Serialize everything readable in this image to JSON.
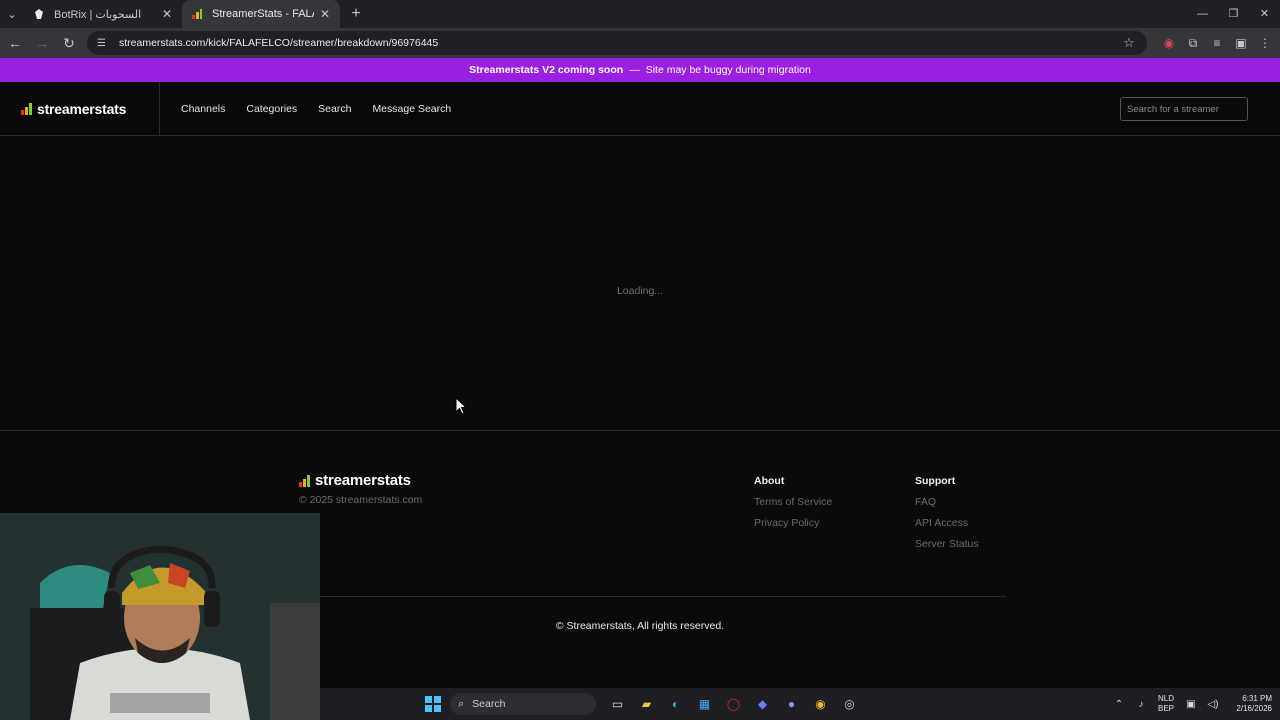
{
  "browser": {
    "tabs": [
      {
        "title": "BotRix | السحوبات",
        "favicon": "botrix-icon",
        "active": false
      },
      {
        "title": "StreamerStats - FALAFELCO Str",
        "favicon": "streamerstats-icon",
        "active": true
      }
    ],
    "url": "streamerstats.com/kick/FALAFELCO/streamer/breakdown/96976445"
  },
  "banner": {
    "strong": "Streamerstats V2 coming soon",
    "separator": "—",
    "text": "Site may be buggy during migration",
    "color": "#9b1fe0"
  },
  "header": {
    "logo": "streamerstats",
    "nav": [
      "Channels",
      "Categories",
      "Search",
      "Message Search"
    ],
    "search_placeholder": "Search for a streamer"
  },
  "main": {
    "status": "Loading..."
  },
  "footer": {
    "logo": "streamerstats",
    "copyright": "© 2025 streamerstats.com",
    "about": {
      "title": "About",
      "links": [
        "Terms of Service",
        "Privacy Policy"
      ]
    },
    "support": {
      "title": "Support",
      "links": [
        "FAQ",
        "API Access",
        "Server Status"
      ]
    },
    "bottom": "© Streamerstats, All rights reserved."
  },
  "taskbar": {
    "search": "Search",
    "lang": [
      "NLD",
      "BEP"
    ],
    "time": "6:31 PM",
    "date": "2/16/2026"
  },
  "logo_colors": [
    "#e5331a",
    "#f5a623",
    "#7ed321"
  ]
}
